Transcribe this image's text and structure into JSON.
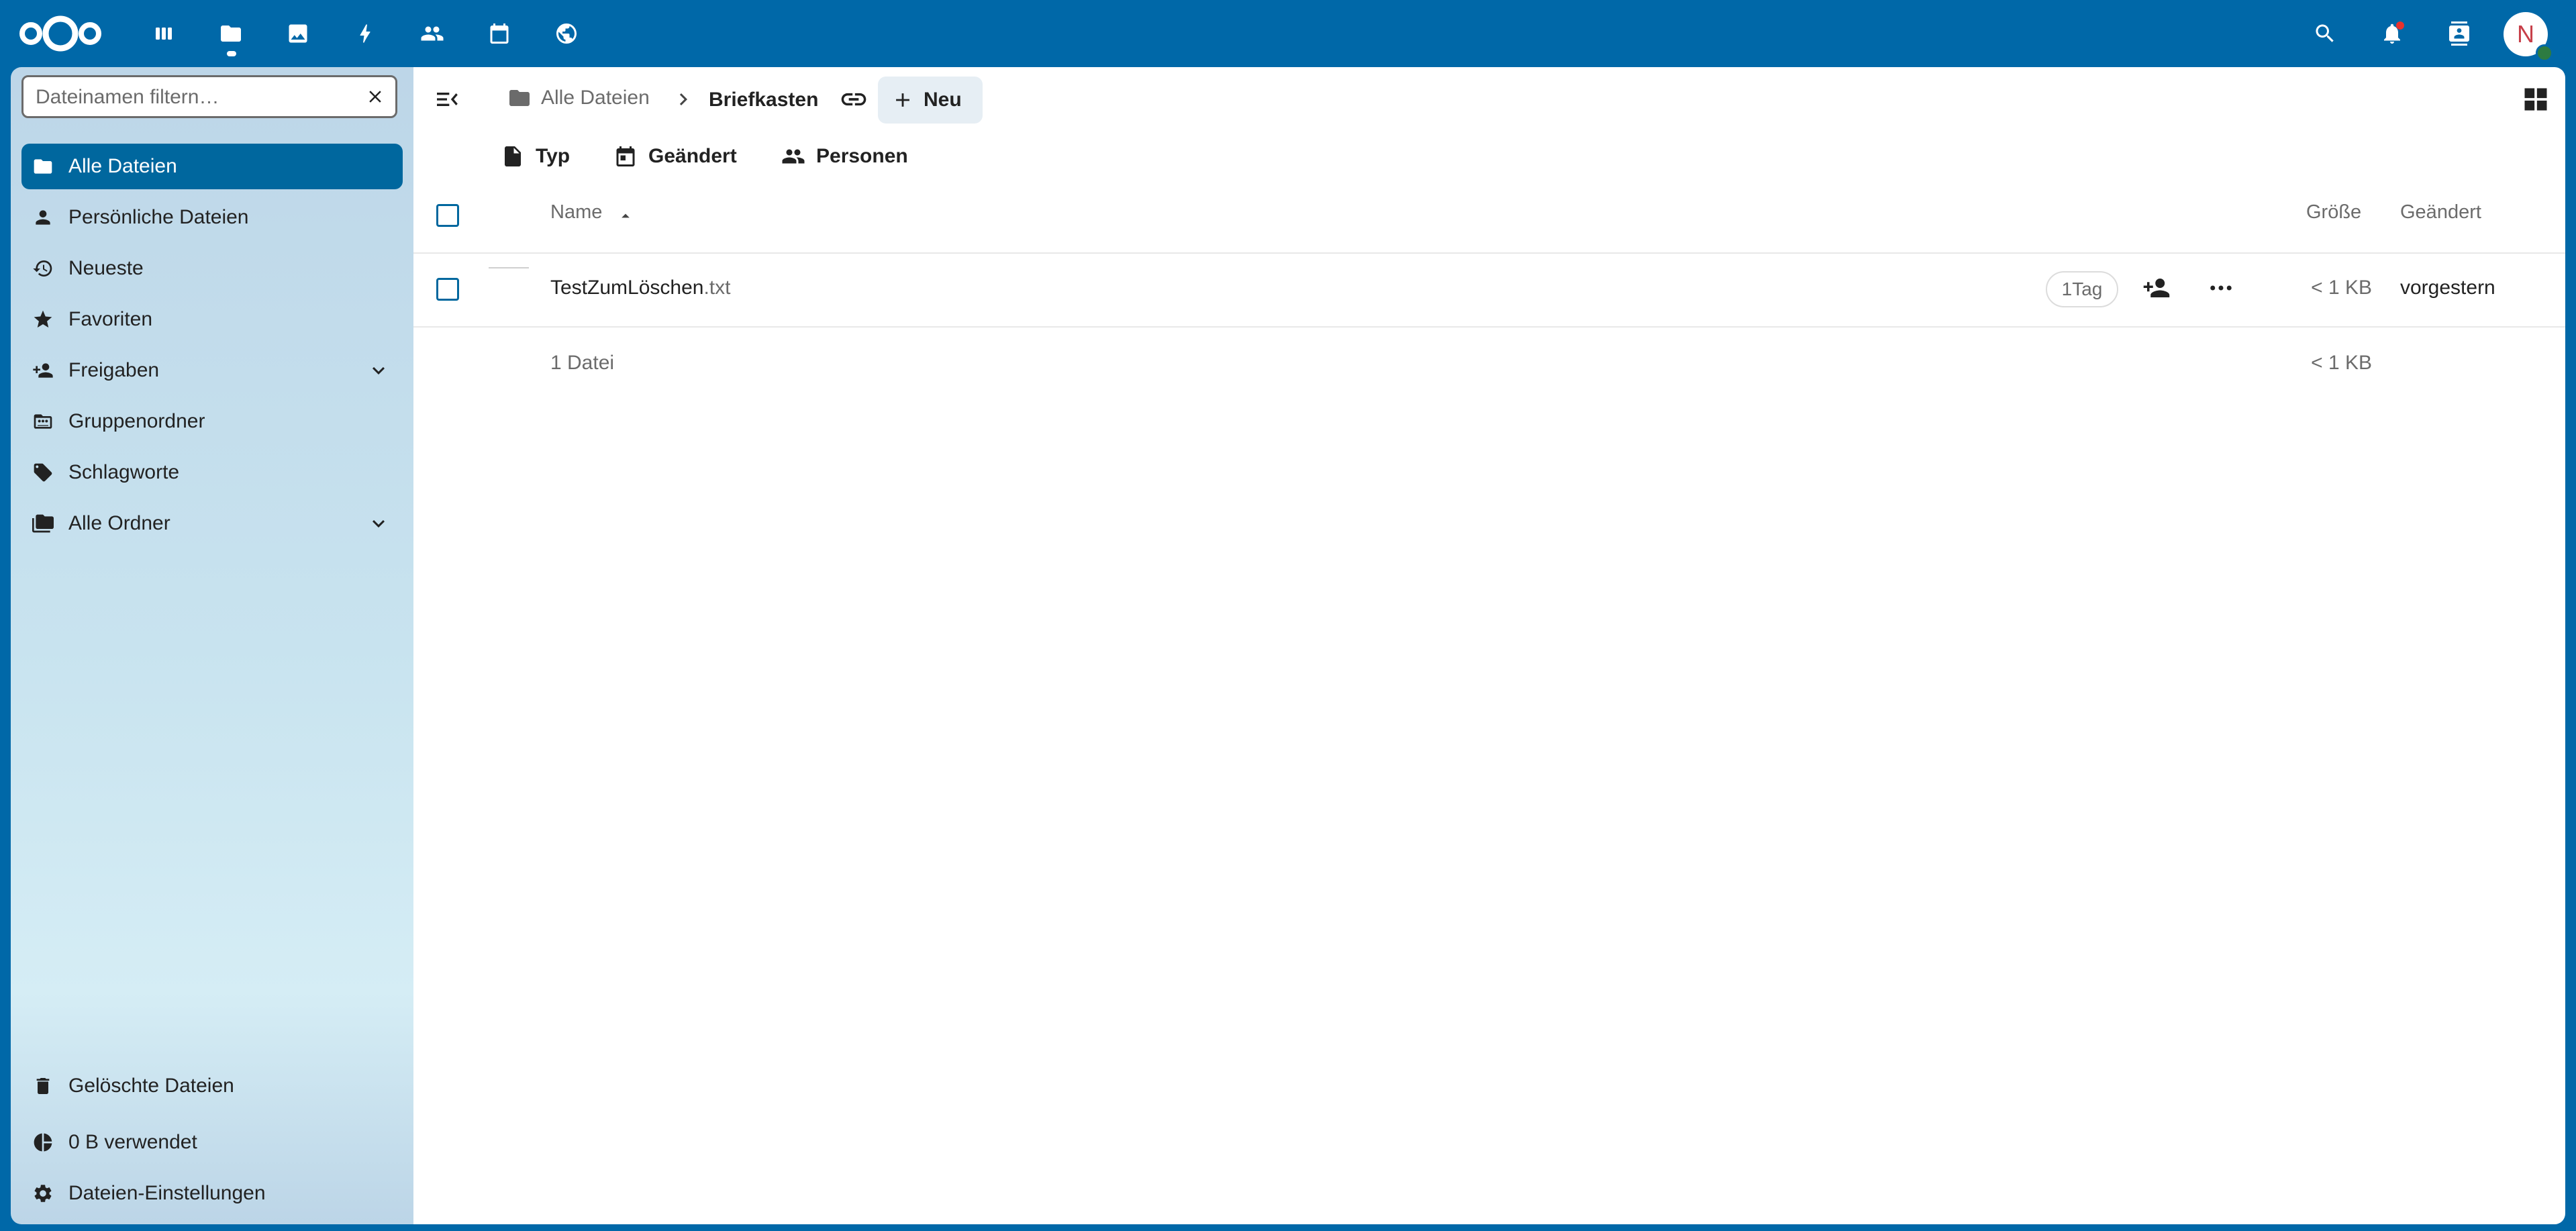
{
  "sidebar": {
    "filter": {
      "placeholder": "Dateinamen filtern…",
      "value": ""
    },
    "items": [
      {
        "label": "Alle Dateien",
        "icon": "folder-icon",
        "active": true
      },
      {
        "label": "Persönliche Dateien",
        "icon": "person-icon"
      },
      {
        "label": "Neueste",
        "icon": "history-icon"
      },
      {
        "label": "Favoriten",
        "icon": "star-icon"
      },
      {
        "label": "Freigaben",
        "icon": "share-icon",
        "expandable": true
      },
      {
        "label": "Gruppenordner",
        "icon": "group-folder-icon"
      },
      {
        "label": "Schlagworte",
        "icon": "tag-icon"
      },
      {
        "label": "Alle Ordner",
        "icon": "folders-icon",
        "expandable": true
      }
    ],
    "bottom_items": [
      {
        "label": "Gelöschte Dateien",
        "icon": "trash-icon"
      },
      {
        "label": "0 B verwendet",
        "icon": "pie-chart-icon"
      },
      {
        "label": "Dateien-Einstellungen",
        "icon": "gear-icon"
      }
    ]
  },
  "breadcrumb": {
    "home": "Alle Dateien",
    "current": "Briefkasten"
  },
  "toolbar": {
    "new_label": "Neu"
  },
  "filters": [
    {
      "label": "Typ",
      "icon": "file-icon"
    },
    {
      "label": "Geändert",
      "icon": "calendar-icon"
    },
    {
      "label": "Personen",
      "icon": "people-icon"
    }
  ],
  "table": {
    "columns": {
      "name": "Name",
      "size": "Größe",
      "modified": "Geändert"
    },
    "rows": [
      {
        "name": "TestZumLöschen",
        "ext": ".txt",
        "tag": "1Tag",
        "size": "< 1 KB",
        "modified": "vorgestern"
      }
    ],
    "summary": {
      "count": "1 Datei",
      "size": "< 1 KB"
    }
  },
  "colors": {
    "header_bg": "#0068a8",
    "active_nav": "#00679e",
    "avatar_letter": "#c73f49",
    "notification_badge": "#e9322d",
    "status_online": "#2d7b41"
  },
  "user": {
    "initial": "N"
  }
}
